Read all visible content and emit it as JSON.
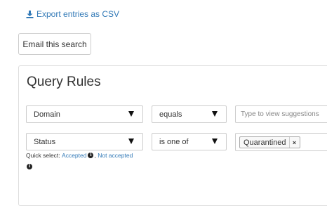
{
  "export": {
    "label": "Export entries as CSV",
    "icon": "download-icon",
    "color": "#337ab7"
  },
  "email_button": {
    "label": "Email this search"
  },
  "query_rules": {
    "title": "Query Rules",
    "rows": [
      {
        "field": "Domain",
        "operator": "equals",
        "value_placeholder": "Type to view suggestions"
      },
      {
        "field": "Status",
        "operator": "is one of",
        "selected_tags": [
          "Quarantined"
        ],
        "tag_remove_symbol": "×"
      }
    ],
    "quick_select": {
      "prefix": "Quick select:",
      "options": [
        "Accepted",
        "Not accepted"
      ],
      "separator": ", ",
      "info_icon": "info-icon",
      "info_glyph": "i"
    }
  }
}
